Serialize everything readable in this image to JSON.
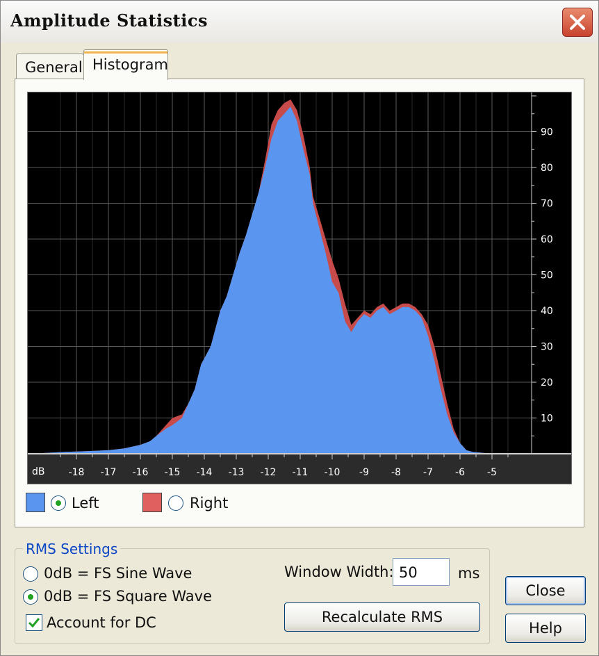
{
  "window": {
    "title": "Amplitude Statistics"
  },
  "tabs": [
    {
      "label": "General"
    },
    {
      "label": "Histogram",
      "selected": true
    }
  ],
  "histogram": {
    "x_unit_label": "dB",
    "x_ticks": [
      "-18",
      "-17",
      "-16",
      "-15",
      "-14",
      "-13",
      "-12",
      "-11",
      "-10",
      "-9",
      "-8",
      "-7",
      "-6",
      "-5"
    ],
    "y_ticks": [
      "10",
      "20",
      "30",
      "40",
      "50",
      "60",
      "70",
      "80",
      "90"
    ],
    "colors": {
      "left": "#5a96f0",
      "right": "#c84b4b",
      "grid": "#5a5a5a",
      "axis_text": "#ffffff",
      "background": "#000000"
    },
    "left_series": [
      [
        -19.5,
        0
      ],
      [
        -18.4,
        0.5
      ],
      [
        -17.5,
        0.8
      ],
      [
        -17,
        1
      ],
      [
        -16.5,
        1.5
      ],
      [
        -16,
        2.5
      ],
      [
        -15.7,
        3.5
      ],
      [
        -15.5,
        5
      ],
      [
        -15.2,
        7
      ],
      [
        -15,
        8
      ],
      [
        -14.7,
        10
      ],
      [
        -14.5,
        14
      ],
      [
        -14.3,
        18
      ],
      [
        -14.1,
        25
      ],
      [
        -13.8,
        30
      ],
      [
        -13.5,
        40
      ],
      [
        -13.3,
        44
      ],
      [
        -13.1,
        50
      ],
      [
        -12.9,
        56
      ],
      [
        -12.7,
        61
      ],
      [
        -12.5,
        67
      ],
      [
        -12.3,
        73
      ],
      [
        -12.1,
        80
      ],
      [
        -11.9,
        88
      ],
      [
        -11.7,
        93
      ],
      [
        -11.5,
        95
      ],
      [
        -11.3,
        97
      ],
      [
        -11.1,
        93
      ],
      [
        -10.9,
        85
      ],
      [
        -10.7,
        78
      ],
      [
        -10.6,
        70
      ],
      [
        -10.4,
        63
      ],
      [
        -10.2,
        56
      ],
      [
        -10,
        48
      ],
      [
        -9.8,
        45
      ],
      [
        -9.6,
        37
      ],
      [
        -9.4,
        34
      ],
      [
        -9.2,
        37
      ],
      [
        -9,
        39
      ],
      [
        -8.8,
        38
      ],
      [
        -8.6,
        40
      ],
      [
        -8.4,
        41
      ],
      [
        -8.2,
        39
      ],
      [
        -8,
        40
      ],
      [
        -7.8,
        41
      ],
      [
        -7.6,
        41
      ],
      [
        -7.4,
        40
      ],
      [
        -7.2,
        38
      ],
      [
        -7,
        33
      ],
      [
        -6.8,
        26
      ],
      [
        -6.6,
        18
      ],
      [
        -6.4,
        11
      ],
      [
        -6.2,
        6
      ],
      [
        -6,
        3
      ],
      [
        -5.8,
        1
      ],
      [
        -5.6,
        0.5
      ],
      [
        -5.2,
        0.2
      ],
      [
        -4.5,
        0
      ]
    ],
    "right_series": [
      [
        -19.5,
        0
      ],
      [
        -18.4,
        0.5
      ],
      [
        -17.5,
        0.8
      ],
      [
        -17,
        1
      ],
      [
        -16.5,
        1.5
      ],
      [
        -16,
        2.5
      ],
      [
        -15.7,
        3.5
      ],
      [
        -15.5,
        5
      ],
      [
        -15.2,
        8
      ],
      [
        -15,
        10
      ],
      [
        -14.7,
        11
      ],
      [
        -14.5,
        14
      ],
      [
        -14.3,
        18
      ],
      [
        -14.1,
        25
      ],
      [
        -13.8,
        30
      ],
      [
        -13.5,
        40
      ],
      [
        -13.3,
        44
      ],
      [
        -13.1,
        50
      ],
      [
        -12.9,
        56
      ],
      [
        -12.7,
        61
      ],
      [
        -12.5,
        67
      ],
      [
        -12.3,
        73
      ],
      [
        -12.1,
        82
      ],
      [
        -11.9,
        92
      ],
      [
        -11.7,
        96
      ],
      [
        -11.5,
        98
      ],
      [
        -11.3,
        99
      ],
      [
        -11.1,
        96
      ],
      [
        -10.9,
        89
      ],
      [
        -10.7,
        80
      ],
      [
        -10.6,
        72
      ],
      [
        -10.4,
        66
      ],
      [
        -10.2,
        60
      ],
      [
        -10,
        54
      ],
      [
        -9.8,
        49
      ],
      [
        -9.6,
        42
      ],
      [
        -9.4,
        36
      ],
      [
        -9.2,
        38
      ],
      [
        -9,
        40
      ],
      [
        -8.8,
        39
      ],
      [
        -8.6,
        41
      ],
      [
        -8.4,
        42
      ],
      [
        -8.2,
        40
      ],
      [
        -8,
        41
      ],
      [
        -7.8,
        42
      ],
      [
        -7.6,
        42
      ],
      [
        -7.4,
        41
      ],
      [
        -7.2,
        39
      ],
      [
        -7,
        36
      ],
      [
        -6.8,
        30
      ],
      [
        -6.6,
        22
      ],
      [
        -6.4,
        14
      ],
      [
        -6.2,
        7
      ],
      [
        -6,
        3
      ],
      [
        -5.8,
        1
      ],
      [
        -5.6,
        0.5
      ],
      [
        -5.2,
        0.2
      ],
      [
        -4.5,
        0
      ]
    ]
  },
  "legend": {
    "left": {
      "label": "Left",
      "selected": true,
      "color": "#5a96f0"
    },
    "right": {
      "label": "Right",
      "selected": false,
      "color": "#e06060"
    }
  },
  "rms_settings": {
    "group_title": "RMS Settings",
    "sine_label": "0dB = FS Sine Wave",
    "square_label": "0dB = FS Square Wave",
    "selected": "square",
    "dc_label": "Account for DC",
    "dc_checked": true,
    "window_width_label": "Window Width:",
    "window_width_value": "50",
    "window_width_unit": "ms",
    "recalculate_label": "Recalculate RMS"
  },
  "buttons": {
    "close": "Close",
    "help": "Help"
  }
}
